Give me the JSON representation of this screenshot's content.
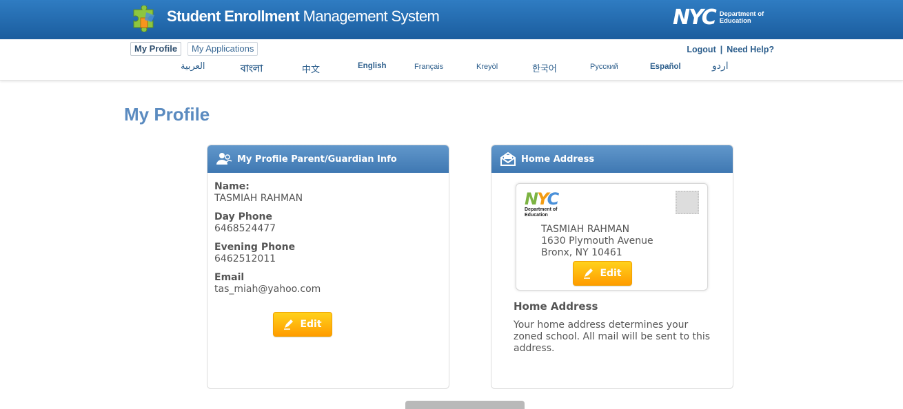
{
  "header": {
    "title_bold": "Student Enrollment",
    "title_rest": " Management System",
    "logo_icon": "puzzle-logo-icon",
    "nyc_word": "NYC",
    "nyc_dept": "Department of Education"
  },
  "nav": {
    "tabs": [
      {
        "label": "My Profile",
        "active": true
      },
      {
        "label": "My Applications",
        "active": false
      }
    ],
    "logout_label": "Logout",
    "separator": "|",
    "help_label": "Need Help?",
    "languages": [
      "العربية",
      "বাংলা",
      "中文",
      "English",
      "Français",
      "Kreyòl",
      "한국어",
      "Русский",
      "Español",
      "اردو"
    ]
  },
  "page": {
    "title": "My Profile"
  },
  "guardian_card": {
    "heading": "My Profile Parent/Guardian Info",
    "icon": "users-icon",
    "fields": [
      {
        "label": "Name:",
        "value": "TASMIAH RAHMAN"
      },
      {
        "label": "Day Phone",
        "value": "6468524477"
      },
      {
        "label": "Evening Phone",
        "value": "6462512011"
      },
      {
        "label": "Email",
        "value": "tas_miah@yahoo.com"
      }
    ],
    "edit_label": "Edit"
  },
  "address_card": {
    "heading": "Home Address",
    "icon": "envelope-icon",
    "envelope": {
      "logo_word": "NYC",
      "logo_dept": "Department of Education",
      "name": "TASMIAH RAHMAN",
      "street": "1630 Plymouth Avenue",
      "city": "Bronx, NY 10461"
    },
    "edit_label": "Edit",
    "info_title": "Home Address",
    "info_text": "Your home address determines your zoned school. All mail will be sent to this address."
  },
  "colors": {
    "header_blue": "#2f7cc2",
    "title_blue": "#5b8bc0",
    "button_orange": "#ff9c00",
    "nyc_green": "#7cb342",
    "nyc_orange": "#f39c12",
    "nyc_blue": "#4a90d9"
  }
}
